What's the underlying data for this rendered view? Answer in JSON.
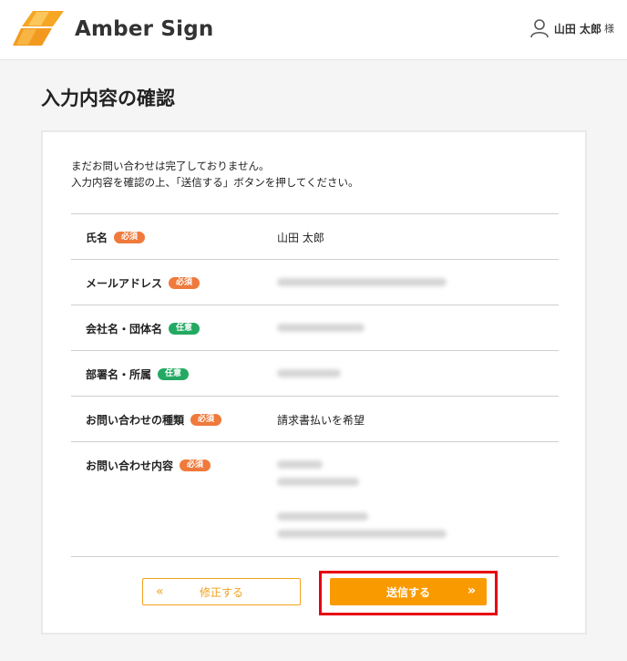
{
  "header": {
    "brand": "Amber Sign",
    "user_name": "山田 太郎",
    "user_suffix": "様",
    "accent_color": "#f5a623"
  },
  "page": {
    "title": "入力内容の確認"
  },
  "intro": {
    "line1": "まだお問い合わせは完了しておりません。",
    "line2": "入力内容を確認の上、「送信する」ボタンを押してください。"
  },
  "badges": {
    "required": "必須",
    "optional": "任意"
  },
  "fields": [
    {
      "label": "氏名",
      "badge": "必須",
      "value": "山田 太郎"
    },
    {
      "label": "メールアドレス",
      "badge": "必須",
      "value": ""
    },
    {
      "label": "会社名・団体名",
      "badge": "任意",
      "value": ""
    },
    {
      "label": "部署名・所属",
      "badge": "任意",
      "value": ""
    },
    {
      "label": "お問い合わせの種類",
      "badge": "必須",
      "value": "請求書払いを希望"
    },
    {
      "label": "お問い合わせ内容",
      "badge": "必須",
      "value": ""
    }
  ],
  "buttons": {
    "back": "修正する",
    "back_icon": "«",
    "send": "送信する",
    "send_icon": "»"
  },
  "colors": {
    "required_badge": "#ef7a3c",
    "optional_badge": "#23a962",
    "send_button": "#f99a00",
    "highlight": "#e60012"
  }
}
